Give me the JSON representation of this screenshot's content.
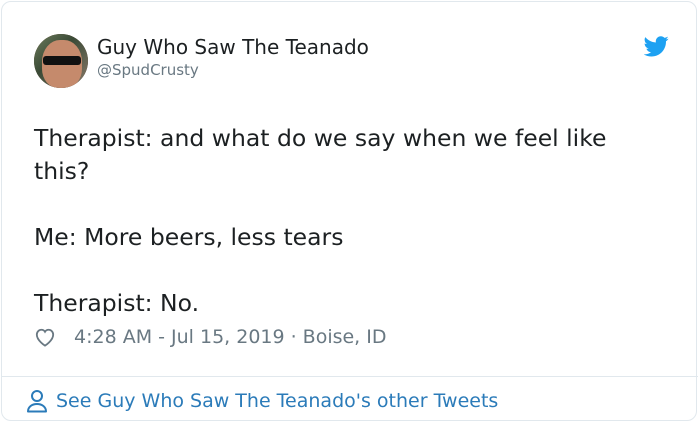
{
  "author": {
    "display_name": "Guy Who Saw The Teanado",
    "handle": "@SpudCrusty",
    "avatar_icon": "profile-photo"
  },
  "brand": {
    "icon": "twitter-bird-icon",
    "color": "#1da1f2"
  },
  "tweet": {
    "lines": [
      "Therapist: and what do we say when we feel like this?",
      "Me: More beers, less tears",
      "Therapist: No."
    ]
  },
  "meta": {
    "like_icon": "heart-icon",
    "timestamp": "4:28 AM - Jul 15, 2019",
    "separator": "·",
    "location": "Boise, ID"
  },
  "footer": {
    "icon": "person-icon",
    "link_text": "See Guy Who Saw The Teanado's other Tweets",
    "link_color": "#2b7bb9"
  }
}
